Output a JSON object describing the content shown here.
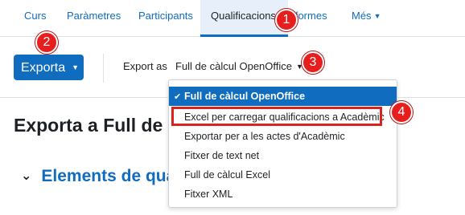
{
  "nav": {
    "items": [
      "Curs",
      "Paràmetres",
      "Participants",
      "Qualificacions",
      "Informes",
      "Més"
    ]
  },
  "toolbar": {
    "export_button": "Exporta",
    "export_as_label": "Export as",
    "export_as_value": "Full de càlcul OpenOffice"
  },
  "page": {
    "title": "Exporta a Full de càlcul OpenOffice",
    "section_title": "Elements de qualificació"
  },
  "dropdown": {
    "options": [
      "Full de càlcul OpenOffice",
      "Excel per carregar qualificacions a Acadèmic",
      "Exportar per a les actes d'Acadèmic",
      "Fitxer de text net",
      "Full de càlcul Excel",
      "Fitxer XML"
    ],
    "selected_index": 0,
    "highlighted_index": 1
  },
  "callouts": [
    "1",
    "2",
    "3",
    "4"
  ],
  "colors": {
    "primary": "#0f6cbf",
    "active_tab_bg": "#e7f0fa",
    "callout_red": "#e81e1e",
    "highlight_red": "#d9231d"
  }
}
